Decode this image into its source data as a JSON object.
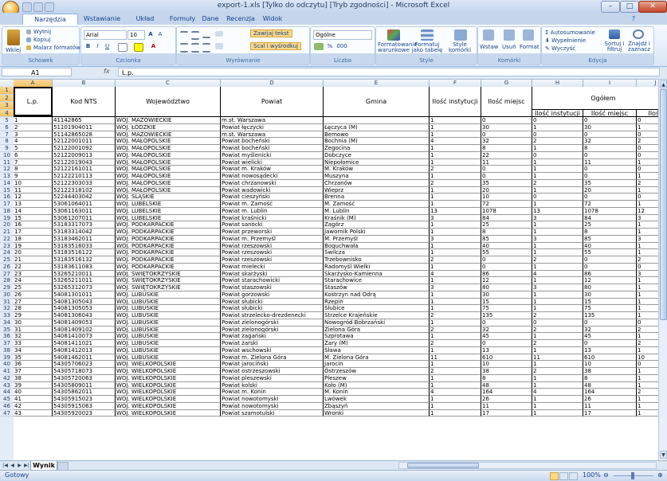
{
  "window": {
    "title": "export-1.xls [Tylko do odczytu] [Tryb zgodności] - Microsoft Excel",
    "minimize": "–",
    "maximize": "□",
    "close": "✕"
  },
  "ribbon": {
    "tabs": [
      "Narzędzia główne",
      "Wstawianie",
      "Układ strony",
      "Formuły",
      "Dane",
      "Recenzja",
      "Widok"
    ],
    "clipboard": {
      "label": "Schowek",
      "paste": "Wklej",
      "cut": "Wytnij",
      "copy": "Kopiuj",
      "painter": "Malarz formatów"
    },
    "font": {
      "label": "Czcionka",
      "name": "Arial",
      "size": "10",
      "bold": "B",
      "italic": "I",
      "underline": "U"
    },
    "alignment": {
      "label": "Wyrównanie",
      "wrap": "Zawijaj tekst",
      "merge": "Scal i wyśrodkuj"
    },
    "number": {
      "label": "Liczba",
      "format": "Ogólne",
      "percent": "%",
      "thousands": "000"
    },
    "styles": {
      "label": "Style",
      "cond": "Formatowanie warunkowe",
      "table": "Formatuj jako tabelę",
      "cell": "Style komórki"
    },
    "cells": {
      "label": "Komórki",
      "insert": "Wstaw",
      "delete": "Usuń",
      "format": "Format"
    },
    "editing": {
      "label": "Edycja",
      "autosum": "Autosumowanie",
      "fill": "Wypełnienie",
      "clear": "Wyczyść",
      "sort": "Sortuj i filtruj",
      "find": "Znajdź i zaznacz"
    }
  },
  "formula_bar": {
    "name_box": "A1",
    "fx": "fx",
    "content": "L.p."
  },
  "columns": [
    "A",
    "B",
    "C",
    "D",
    "E",
    "F",
    "G",
    "H",
    "I",
    "J"
  ],
  "header": {
    "lp": "L.p.",
    "kod": "Kod NTS",
    "woj": "Województwo",
    "powiat": "Powiat",
    "gmina": "Gmina",
    "inst": "Ilość instytucji",
    "miejsc": "Ilość miejsc",
    "ogolem": "Ogółem",
    "sub_inst": "Ilość instytucji",
    "sub_miejsc": "Ilość miejsc",
    "sub_j": "Ilość"
  },
  "rows": [
    [
      "1",
      "41142865",
      "WOJ. MAZOWIECKIE",
      "m.st. Warszawa",
      "",
      "1",
      "0",
      "0",
      "0",
      "0"
    ],
    [
      "2",
      "51101904011",
      "WOJ. ŁÓDZKIE",
      "Powiat łęczycki",
      "Łęczyca (M)",
      "1",
      "30",
      "1",
      "30",
      "1"
    ],
    [
      "3",
      "51142865028",
      "WOJ. MAZOWIECKIE",
      "m.st. Warszawa",
      "Bemowo",
      "1",
      "0",
      "0",
      "0",
      "0"
    ],
    [
      "4",
      "52122001011",
      "WOJ. MAŁOPOLSKIE",
      "Powiat bocheński",
      "Bochnia (M)",
      "4",
      "32",
      "2",
      "32",
      "2"
    ],
    [
      "5",
      "52122001092",
      "WOJ. MAŁOPOLSKIE",
      "Powiat bocheński",
      "Żegocina",
      "1",
      "8",
      "1",
      "8",
      "0"
    ],
    [
      "6",
      "52122009013",
      "WOJ. MAŁOPOLSKIE",
      "Powiat myślenicki",
      "Dobczyce",
      "1",
      "22",
      "0",
      "0",
      "0"
    ],
    [
      "7",
      "52122019043",
      "WOJ. MAŁOPOLSKIE",
      "Powiat wielicki",
      "Niepołomice",
      "1",
      "11",
      "1",
      "11",
      "1"
    ],
    [
      "8",
      "52122161011",
      "WOJ. MAŁOPOLSKIE",
      "Powiat m. Kraków",
      "M. Kraków",
      "2",
      "0",
      "1",
      "0",
      "0"
    ],
    [
      "9",
      "52122210113",
      "WOJ. MAŁOPOLSKIE",
      "Powiat nowosądecki",
      "Muszyna",
      "1",
      "0",
      "1",
      "0",
      "1"
    ],
    [
      "10",
      "52122303033",
      "WOJ. MAŁOPOLSKIE",
      "Powiat chrzanowski",
      "Chrzanów",
      "2",
      "35",
      "2",
      "35",
      "2"
    ],
    [
      "11",
      "52122318102",
      "WOJ. MAŁOPOLSKIE",
      "Powiat wadowicki",
      "Wieprz",
      "1",
      "20",
      "1",
      "20",
      "1"
    ],
    [
      "12",
      "52244403042",
      "WOJ. ŚLĄSKIE",
      "Powiat cieszyński",
      "Brenna",
      "1",
      "10",
      "0",
      "0",
      "0"
    ],
    [
      "13",
      "53061064011",
      "WOJ. LUBELSKIE",
      "Powiat m. Zamość",
      "M. Zamość",
      "1",
      "72",
      "1",
      "72",
      "1"
    ],
    [
      "14",
      "53061163011",
      "WOJ. LUBELSKIE",
      "Powiat m. Lublin",
      "M. Lublin",
      "13",
      "1078",
      "13",
      "1078",
      "12"
    ],
    [
      "15",
      "53061207011",
      "WOJ. LUBELSKIE",
      "Powiat kraśnicki",
      "Kraśnik (M)",
      "3",
      "84",
      "3",
      "84",
      "3"
    ],
    [
      "16",
      "53183317073",
      "WOJ. PODKARPACKIE",
      "Powiat sanocki",
      "Zagórz",
      "1",
      "25",
      "1",
      "25",
      "1"
    ],
    [
      "17",
      "53183314042",
      "WOJ. PODKARPACKIE",
      "Powiat przeworski",
      "Jawornik Polski",
      "1",
      "8",
      "1",
      "8",
      "1"
    ],
    [
      "18",
      "53183462011",
      "WOJ. PODKARPACKIE",
      "Powiat m. Przemyśl",
      "M. Przemyśl",
      "3",
      "85",
      "3",
      "85",
      "3"
    ],
    [
      "19",
      "53183516033",
      "WOJ. PODKARPACKIE",
      "Powiat rzeszowski",
      "Boguchwała",
      "1",
      "40",
      "1",
      "40",
      "1"
    ],
    [
      "20",
      "53183516122",
      "WOJ. PODKARPACKIE",
      "Powiat rzeszowski",
      "Świlcza",
      "1",
      "55",
      "1",
      "55",
      "1"
    ],
    [
      "21",
      "53183516132",
      "WOJ. PODKARPACKIE",
      "Powiat rzeszowski",
      "Trzebownisko",
      "2",
      "0",
      "2",
      "0",
      "2"
    ],
    [
      "22",
      "53183611083",
      "WOJ. PODKARPACKIE",
      "Powiat mielecki",
      "Radomyśl Wielki",
      "1",
      "0",
      "1",
      "0",
      "0"
    ],
    [
      "23",
      "53265210011",
      "WOJ. ŚWIĘTOKRZYSKIE",
      "Powiat skarżyski",
      "Skarżysko-Kamienna",
      "4",
      "86",
      "4",
      "86",
      "3"
    ],
    [
      "24",
      "53265211011",
      "WOJ. ŚWIĘTOKRZYSKIE",
      "Powiat starachowicki",
      "Starachowice",
      "1",
      "12",
      "1",
      "12",
      "1"
    ],
    [
      "25",
      "53265312073",
      "WOJ. ŚWIĘTOKRZYSKIE",
      "Powiat staszowski",
      "Staszów",
      "3",
      "80",
      "3",
      "80",
      "1"
    ],
    [
      "26",
      "54081301011",
      "WOJ. LUBUSKIE",
      "Powiat gorzowski",
      "Kostrzyn nad Odrą",
      "1",
      "30",
      "1",
      "30",
      "1"
    ],
    [
      "27",
      "54081305043",
      "WOJ. LUBUSKIE",
      "Powiat słubicki",
      "Rzepin",
      "1",
      "15",
      "1",
      "15",
      "1"
    ],
    [
      "28",
      "54081305053",
      "WOJ. LUBUSKIE",
      "Powiat słubicki",
      "Słubice",
      "1",
      "75",
      "1",
      "75",
      "1"
    ],
    [
      "29",
      "54081306043",
      "WOJ. LUBUSKIE",
      "Powiat strzelecko-drezdenecki",
      "Strzelce Krajeńskie",
      "2",
      "135",
      "2",
      "135",
      "1"
    ],
    [
      "30",
      "54081409053",
      "WOJ. LUBUSKIE",
      "Powiat zielonogórski",
      "Nowogród Bobrzański",
      "1",
      "0",
      "0",
      "0",
      "0"
    ],
    [
      "31",
      "54081409102",
      "WOJ. LUBUSKIE",
      "Powiat zielonogórski",
      "Zielona Góra",
      "2",
      "32",
      "2",
      "32",
      "2"
    ],
    [
      "32",
      "54081410073",
      "WOJ. LUBUSKIE",
      "Powiat żagański",
      "Szprotawa",
      "1",
      "45",
      "1",
      "45",
      "1"
    ],
    [
      "33",
      "54081411021",
      "WOJ. LUBUSKIE",
      "Powiat żarski",
      "Żary (M)",
      "2",
      "0",
      "2",
      "0",
      "2"
    ],
    [
      "34",
      "54081412013",
      "WOJ. LUBUSKIE",
      "Powiat wschowski",
      "Sława",
      "1",
      "13",
      "1",
      "13",
      "1"
    ],
    [
      "35",
      "54081462011",
      "WOJ. LUBUSKIE",
      "Powiat m. Zielona Góra",
      "M. Zielona Góra",
      "11",
      "610",
      "11",
      "610",
      "10"
    ],
    [
      "36",
      "54305706023",
      "WOJ. WIELKOPOLSKIE",
      "Powiat jarociński",
      "Jarocin",
      "1",
      "10",
      "1",
      "10",
      "0"
    ],
    [
      "37",
      "54305718073",
      "WOJ. WIELKOPOLSKIE",
      "Powiat ostrzeszowski",
      "Ostrzeszów",
      "2",
      "38",
      "2",
      "38",
      "1"
    ],
    [
      "38",
      "54305720063",
      "WOJ. WIELKOPOLSKIE",
      "Powiat pleszewski",
      "Pleszew",
      "1",
      "8",
      "1",
      "8",
      "1"
    ],
    [
      "39",
      "54305809011",
      "WOJ. WIELKOPOLSKIE",
      "Powiat kolski",
      "Koło (M)",
      "1",
      "48",
      "1",
      "48",
      "1"
    ],
    [
      "40",
      "54305862011",
      "WOJ. WIELKOPOLSKIE",
      "Powiat m. Konin",
      "M. Konin",
      "4",
      "164",
      "4",
      "164",
      "2"
    ],
    [
      "41",
      "54305915023",
      "WOJ. WIELKOPOLSKIE",
      "Powiat nowotomyski",
      "Lwówek",
      "1",
      "26",
      "1",
      "26",
      "1"
    ],
    [
      "42",
      "54305915063",
      "WOJ. WIELKOPOLSKIE",
      "Powiat nowotomyski",
      "Zbąszyń",
      "1",
      "11",
      "1",
      "11",
      "1"
    ],
    [
      "43",
      "54305920023",
      "WOJ. WIELKOPOLSKIE",
      "Powiat szamotulski",
      "Wronki",
      "1",
      "17",
      "1",
      "17",
      "1"
    ]
  ],
  "sheet_tab": "Wynik",
  "status": {
    "text": "Gotowy",
    "zoom": "100%"
  }
}
